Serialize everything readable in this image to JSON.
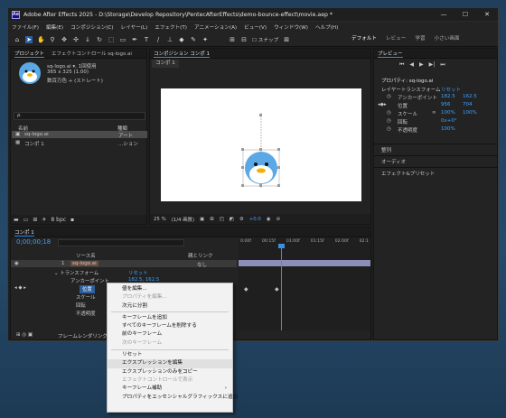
{
  "app": {
    "title": "Adobe After Effects 2025 - D:\\Storage\\Develop Repository\\PentecAfterEffects\\demo-bounce-effect\\movie.aep *",
    "logo": "Ae"
  },
  "menu": [
    "ファイル(F)",
    "編集(E)",
    "コンポジション(C)",
    "レイヤー(L)",
    "エフェクト(T)",
    "アニメーション(A)",
    "ビュー(V)",
    "ウィンドウ(W)",
    "ヘルプ(H)"
  ],
  "toolbar": {
    "snap": "スナップ",
    "workspaces": [
      "デフォルト",
      "レビュー",
      "学習",
      "小さい画面"
    ]
  },
  "project": {
    "tab": "プロジェクト",
    "effects_tab": "エフェクトコントロール sq-logo.ai",
    "file_name": "sq-logo.ai ▾, 1回使用",
    "file_size": "365 x 325 (1.00)",
    "file_color": "数百万色 + (ストレート)",
    "search_placeholder": "ρ",
    "columns": {
      "name": "名前",
      "type": "種類"
    },
    "items": [
      {
        "name": "sq-logo.ai",
        "type": "アート"
      },
      {
        "name": "コンポ 1",
        "type": "...ション"
      }
    ],
    "bpc": "8 bpc"
  },
  "comp": {
    "tab": "コンポジション コンポ 1",
    "subtab": "コンポ 1",
    "zoom": "25 %",
    "quality": "(1/4 画質)",
    "exposure": "+0.0",
    "time": "0;00;00;18"
  },
  "preview": {
    "tab": "プレビュー"
  },
  "properties": {
    "title": "プロパティ: sq-logo.ai",
    "section": "レイヤートランスフォーム",
    "reset": "リセット",
    "rows": [
      {
        "label": "アンカーポイント",
        "v1": "182.5",
        "v2": "162.5"
      },
      {
        "label": "位置",
        "v1": "956",
        "v2": "704"
      },
      {
        "label": "スケール",
        "v1": "100%",
        "v2": "100%"
      },
      {
        "label": "回転",
        "v1": "0x+0°",
        "v2": ""
      },
      {
        "label": "不透明度",
        "v1": "100%",
        "v2": ""
      }
    ],
    "groups": [
      "整列",
      "オーディオ",
      "エフェクト&プリセット"
    ]
  },
  "timeline": {
    "tab": "コンポ 1",
    "time": "0;00;00;18",
    "col_source": "ソース名",
    "col_parent": "親とリンク",
    "layer_num": "1",
    "layer_name": "sq-logo.ai",
    "parent": "なし",
    "transform": "トランスフォーム",
    "reset": "リセット",
    "props": [
      {
        "name": "アンカーポイント",
        "value": "182.5, 162.5"
      },
      {
        "name": "位置",
        "value": ""
      },
      {
        "name": "スケール",
        "value": ""
      },
      {
        "name": "回転",
        "value": ""
      },
      {
        "name": "不透明度",
        "value": ""
      }
    ],
    "render_time": "フレームレンダリング時間",
    "ticks": [
      "0:00f",
      "00:15f",
      "01:00f",
      "01:15f",
      "02:00f",
      "02:1"
    ]
  },
  "context_menu": [
    {
      "label": "値を編集...",
      "disabled": false
    },
    {
      "label": "プロパティを編集...",
      "disabled": true
    },
    {
      "label": "次元に分割",
      "disabled": false
    },
    {
      "sep": true
    },
    {
      "label": "キーフレームを追加",
      "disabled": false
    },
    {
      "label": "すべてのキーフレームを削除する",
      "disabled": false
    },
    {
      "label": "前のキーフレーム",
      "disabled": false
    },
    {
      "label": "次のキーフレーム",
      "disabled": true
    },
    {
      "sep": true
    },
    {
      "label": "リセット",
      "disabled": false
    },
    {
      "label": "エクスプレッションを編集",
      "disabled": false,
      "hl": true
    },
    {
      "label": "エクスプレッションのみをコピー",
      "disabled": false
    },
    {
      "label": "エフェクトコントロールで表示",
      "disabled": true
    },
    {
      "label": "キーフレーム補助",
      "disabled": false,
      "sub": true
    },
    {
      "label": "プロパティをエッセンシャルグラフィックスに追加",
      "disabled": false
    }
  ]
}
